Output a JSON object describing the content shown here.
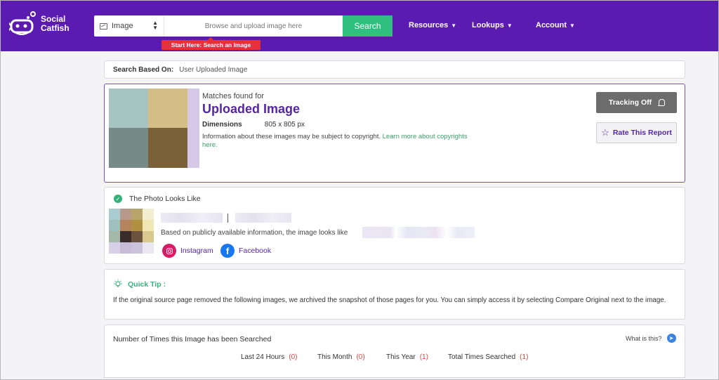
{
  "brand": {
    "logo_line1": "Social",
    "logo_line2": "Catfish",
    "color": "#5b1bb0",
    "accent": "#2fbf7f"
  },
  "search": {
    "type_label": "Image",
    "upload_placeholder": "Browse and upload image here",
    "button_label": "Search",
    "start_tag": "Start Here: Search an Image"
  },
  "nav": {
    "resources": "Resources",
    "lookups": "Lookups",
    "account": "Account"
  },
  "based_on": {
    "label": "Search Based On:",
    "value": "User Uploaded Image"
  },
  "match": {
    "matches_for": "Matches found for",
    "title": "Uploaded Image",
    "dimensions_label": "Dimensions",
    "dimensions_value": "805 x 805 px",
    "copyright_text": "Information about these images may be subject to copyright.",
    "copyright_link": "Learn more about copyrights here.",
    "tracking_label": "Tracking Off",
    "rate_label": "Rate This Report"
  },
  "looks_like": {
    "title": "The Photo Looks Like",
    "based_text": "Based on publicly available information, the image looks like",
    "social": [
      {
        "label": "Instagram",
        "icon": "instagram-icon"
      },
      {
        "label": "Facebook",
        "icon": "facebook-icon"
      }
    ]
  },
  "tip": {
    "title": "Quick Tip :",
    "body": "If the original source page removed the following images, we archived the snapshot of those pages for you. You can simply access it by selecting Compare Original next to the image."
  },
  "counts": {
    "title": "Number of Times this Image has been Searched",
    "what_label": "What is this?",
    "stats": [
      {
        "label": "Last 24 Hours",
        "value": "(0)"
      },
      {
        "label": "This Month",
        "value": "(0)"
      },
      {
        "label": "This Year",
        "value": "(1)"
      },
      {
        "label": "Total Times Searched",
        "value": "(1)"
      }
    ]
  }
}
